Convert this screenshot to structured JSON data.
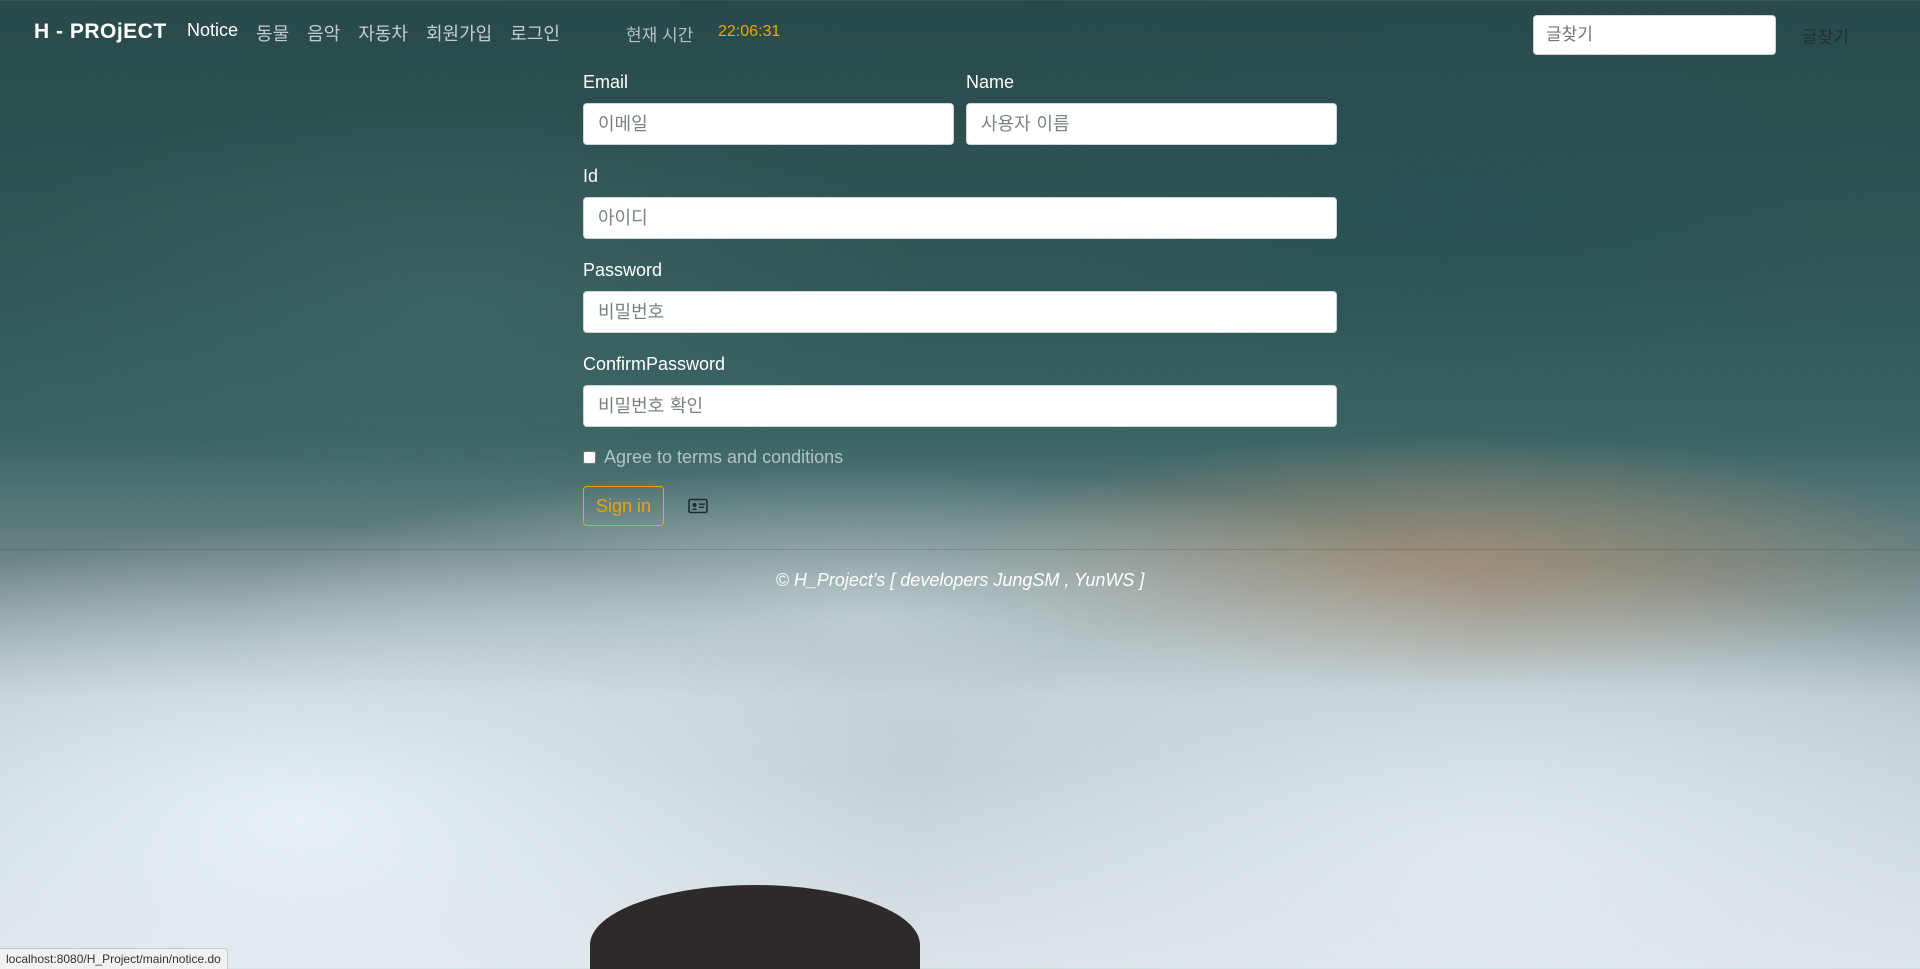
{
  "navbar": {
    "brand": "H - PROjECT",
    "links": [
      "Notice",
      "동물",
      "음악",
      "자동차",
      "회원가입",
      "로그인"
    ],
    "clock_label": "현재 시간",
    "clock_time": "22:06:31",
    "search_placeholder": "글찾기",
    "search_button": "글찾기"
  },
  "form": {
    "email_label": "Email",
    "email_placeholder": "이메일",
    "name_label": "Name",
    "name_placeholder": "사용자 이름",
    "id_label": "Id",
    "id_placeholder": "아이디",
    "password_label": "Password",
    "password_placeholder": "비밀번호",
    "confirm_label": "ConfirmPassword",
    "confirm_placeholder": "비밀번호 확인",
    "terms_label": "Agree to terms and conditions",
    "terms_checked": false,
    "signin_button": "Sign in",
    "card_icon": "id-card-icon"
  },
  "footer": {
    "text": "© H_Project's [ developers JungSM , YunWS ]"
  },
  "status_bar": {
    "url": "localhost:8080/H_Project/main/notice.do"
  },
  "colors": {
    "accent": "#f0a500",
    "text": "#ffffff"
  }
}
